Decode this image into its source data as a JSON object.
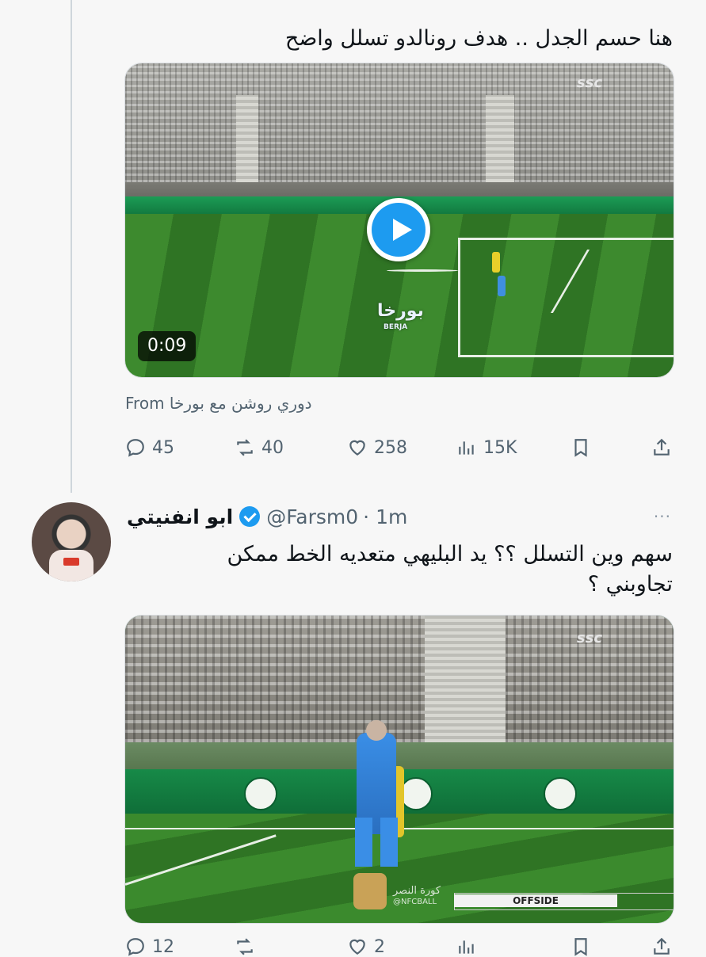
{
  "parent_tweet": {
    "text": "هنا حسم الجدل .. هدف رونالدو تسلل واضح",
    "video": {
      "duration": "0:09",
      "broadcaster_logo": "ssc",
      "watermark_ar": "بورخا",
      "watermark_en": "BERJA"
    },
    "from_label": "From",
    "from_source": "دوري روشن مع بورخا",
    "actions": {
      "replies": "45",
      "retweets": "40",
      "likes": "258",
      "views": "15K"
    }
  },
  "reply_tweet": {
    "display_name": "ابو انفنيتي",
    "handle": "@Farsm0",
    "time": "· 1m",
    "more": "···",
    "text_line1": "سهم وين التسلل ؟؟ يد البليهي متعديه الخط ممكن",
    "text_line2": "تجاوبني ؟",
    "video": {
      "broadcaster_logo": "ssc",
      "overlay_label": "OFFSIDE",
      "club_text": "كورة النصر",
      "club_handle": "@NFCBALL"
    },
    "actions": {
      "replies": "12",
      "likes": "2"
    }
  },
  "colors": {
    "accent": "#1d9bf0",
    "muted_text": "#536471",
    "pitch_green": "#3d8a2e"
  },
  "icons": [
    "reply-icon",
    "retweet-icon",
    "like-icon",
    "views-icon",
    "bookmark-icon",
    "share-icon",
    "play-icon",
    "verified-icon",
    "more-icon"
  ]
}
